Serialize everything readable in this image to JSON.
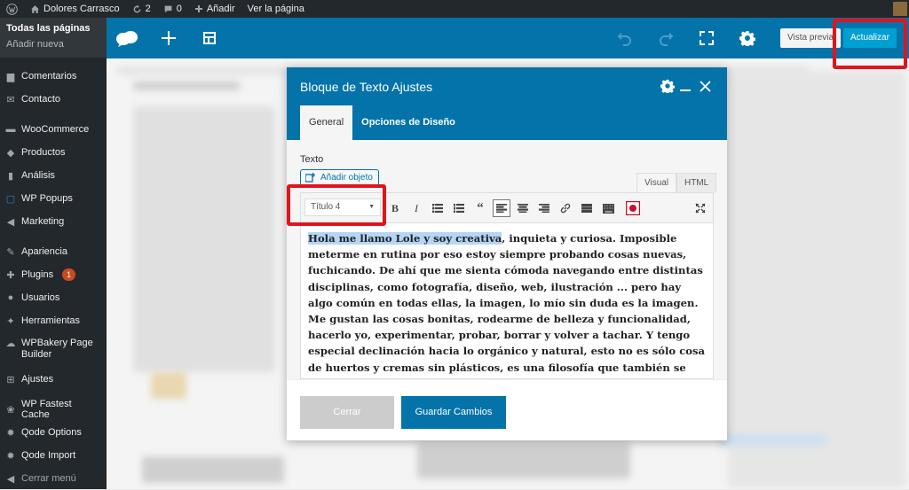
{
  "adminbar": {
    "site_name": "Dolores Carrasco",
    "updates_count": "2",
    "comments_count": "0",
    "new_label": "Añadir",
    "view_page": "Ver la página"
  },
  "sidebar": {
    "sub_current": "Todas las páginas",
    "sub_add": "Añadir nueva",
    "items": [
      {
        "label": "Comentarios",
        "icon": "comment-icon"
      },
      {
        "label": "Contacto",
        "icon": "mail-icon"
      },
      {
        "label": "WooCommerce",
        "icon": "woocommerce-icon"
      },
      {
        "label": "Productos",
        "icon": "products-icon"
      },
      {
        "label": "Análisis",
        "icon": "chart-icon"
      },
      {
        "label": "WP Popups",
        "icon": "popup-icon"
      },
      {
        "label": "Marketing",
        "icon": "megaphone-icon"
      },
      {
        "label": "Apariencia",
        "icon": "brush-icon"
      },
      {
        "label": "Plugins",
        "icon": "plugin-icon",
        "badge": "1"
      },
      {
        "label": "Usuarios",
        "icon": "user-icon"
      },
      {
        "label": "Herramientas",
        "icon": "wrench-icon"
      },
      {
        "label": "WPBakery Page Builder",
        "icon": "wpbakery-icon"
      },
      {
        "label": "Ajustes",
        "icon": "settings-icon"
      },
      {
        "label": "WP Fastest Cache",
        "icon": "cheetah-icon"
      },
      {
        "label": "Qode Options",
        "icon": "gear-icon"
      },
      {
        "label": "Qode Import",
        "icon": "gear-icon"
      },
      {
        "label": "Cerrar menú",
        "icon": "collapse-icon"
      }
    ]
  },
  "builder": {
    "preview_label": "Vista previa",
    "update_label": "Actualizar"
  },
  "modal": {
    "title": "Bloque de Texto Ajustes",
    "tabs": [
      "General",
      "Opciones de Diseño"
    ],
    "field_label": "Texto",
    "add_object": "Añadir objeto",
    "editor_tabs": {
      "visual": "Visual",
      "html": "HTML"
    },
    "format_select": "Título 4",
    "content_selected": "Hola me llamo Lole y soy creativa",
    "content_rest": ", inquieta y curiosa. Imposible meterme en rutina por eso estoy siempre probando cosas nuevas, fuchicando. De ahí que me sienta cómoda navegando entre distintas disciplinas, como fotografía, diseño, web, ilustración ... pero hay algo común en todas ellas, la imagen, lo mío sin duda es la imagen. Me gustan las cosas bonitas, rodearme de belleza y funcionalidad, hacerlo yo, experimentar, probar, borrar y volver a tachar. Y tengo especial declinación hacia lo orgánico y natural, esto no es sólo cosa de huertos y cremas sin plásticos, es una filosofía que también se aplica a todo tu",
    "close_label": "Cerrar",
    "save_label": "Guardar Cambios"
  },
  "colors": {
    "builder_blue": "#0473aa",
    "update_blue": "#00a0d2",
    "highlight_red": "#e0141c",
    "admin_dark": "#23282d"
  }
}
